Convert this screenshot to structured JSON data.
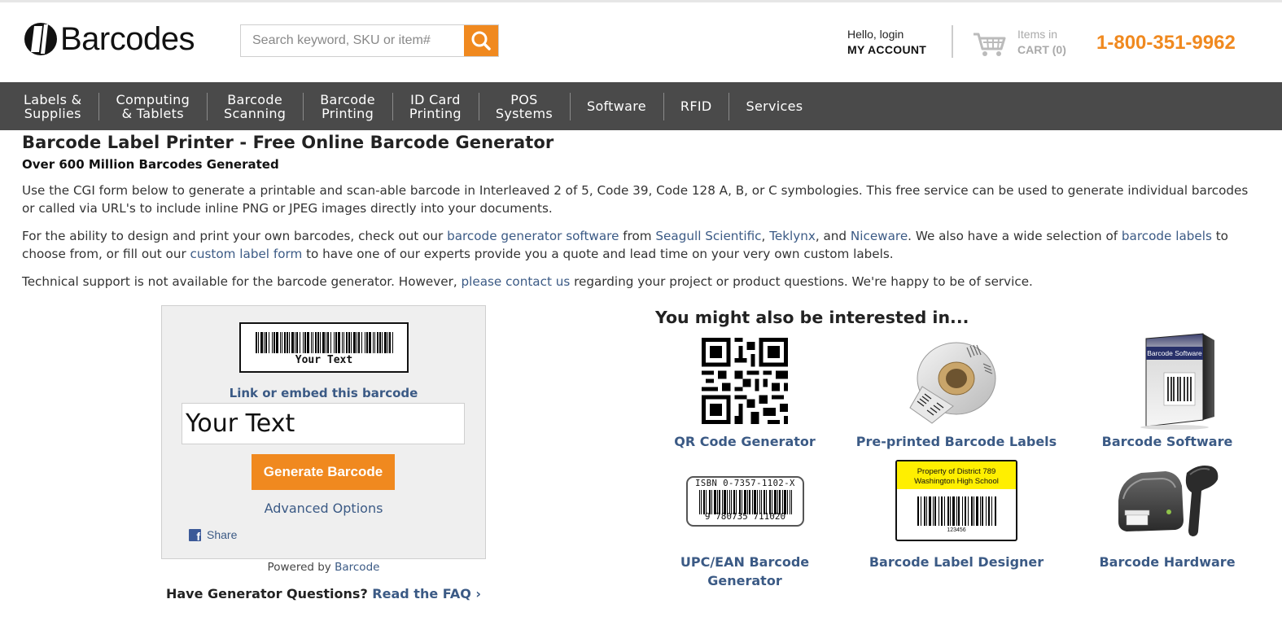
{
  "header": {
    "logo_text": "Barcodes",
    "search_placeholder": "Search keyword, SKU or item#",
    "account_hello": "Hello, login",
    "account_label": "MY ACCOUNT",
    "cart_line1": "Items in",
    "cart_line2": "CART (0)",
    "phone": "1-800-351-9962"
  },
  "nav": {
    "items": [
      {
        "line1": "Labels &",
        "line2": "Supplies"
      },
      {
        "line1": "Computing",
        "line2": "& Tablets"
      },
      {
        "line1": "Barcode",
        "line2": "Scanning"
      },
      {
        "line1": "Barcode",
        "line2": "Printing"
      },
      {
        "line1": "ID Card",
        "line2": "Printing"
      },
      {
        "line1": "POS",
        "line2": "Systems"
      },
      {
        "line1": "Software",
        "line2": ""
      },
      {
        "line1": "RFID",
        "line2": ""
      },
      {
        "line1": "Services",
        "line2": ""
      }
    ]
  },
  "content": {
    "title": "Barcode Label Printer - Free Online Barcode Generator",
    "subtitle": "Over 600 Million Barcodes Generated",
    "p1": "Use the CGI form below to generate a printable and scan-able barcode in Interleaved 2 of 5, Code 39, Code 128 A, B, or C symbologies. This free service can be used to generate individual barcodes or called via URL's to include inline PNG or JPEG images directly into your documents.",
    "p2": {
      "t1": "For the ability to design and print your own barcodes, check out our ",
      "link1": "barcode generator software",
      "t2": " from ",
      "link2": "Seagull Scientific",
      "t3": ", ",
      "link3": "Teklynx",
      "t4": ", and ",
      "link4": "Niceware",
      "t5": ". We also have a wide selection of ",
      "link5": "barcode labels",
      "t6": " to choose from, or fill out our ",
      "link6": "custom label form",
      "t7": " to have one of our experts provide you a quote and lead time on your very own custom labels."
    },
    "p3": {
      "t1": "Technical support is not available for the barcode generator. However, ",
      "link1": "please contact us",
      "t2": " regarding your project or product questions. We're happy to be of service."
    }
  },
  "generator": {
    "preview_text": "Your Text",
    "embed_link": "Link or embed this barcode",
    "input_value": "Your Text",
    "generate_button": "Generate Barcode",
    "advanced_options": "Advanced Options",
    "share": "Share",
    "powered_prefix": "Powered by ",
    "powered_link": "Barcode",
    "faq_question": "Have Generator Questions? ",
    "faq_link": "Read the FAQ ›"
  },
  "interested": {
    "heading": "You might also be interested in...",
    "products": [
      {
        "label": "QR Code Generator",
        "icon": "qr-code-icon"
      },
      {
        "label": "Pre-printed Barcode Labels",
        "icon": "label-roll-icon"
      },
      {
        "label": "Barcode Software",
        "icon": "software-box-icon"
      },
      {
        "label": "UPC/EAN Barcode",
        "label2": "Generator",
        "icon": "upc-barcode-icon",
        "isbn_text": "ISBN 0-7357-1102-X",
        "digits": "9 780735 711020"
      },
      {
        "label": "Barcode Label Designer",
        "icon": "label-designer-icon",
        "label_line1": "Property of District 789",
        "label_line2": "Washington High School",
        "label_number": "123456"
      },
      {
        "label": "Barcode Hardware",
        "icon": "hardware-icon",
        "box_text": "Barcode Software"
      }
    ]
  },
  "colors": {
    "accent": "#f0891f",
    "nav_bg": "#4a4a4a",
    "link": "#3b5a85"
  }
}
